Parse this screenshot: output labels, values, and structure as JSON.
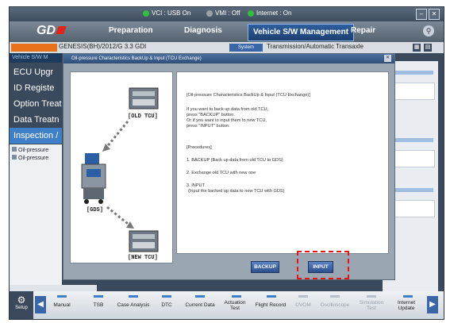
{
  "status": {
    "vci": "VCI : USB On",
    "vmi": "VMI : Off",
    "internet": "Internet : On",
    "vci_color": "#2fbf3a",
    "internet_color": "#2fbf3a"
  },
  "nav": {
    "logo": "GD",
    "tabs": [
      "Preparation",
      "Diagnosis",
      "Vehicle S/W Management",
      "Repair"
    ],
    "active_tab": "Vehicle S/W Management"
  },
  "vehicle": {
    "name": "GENESIS(BH)/2012/G 3.3 GDI",
    "system_button": "System",
    "system_value": "Transmission/Automatic Transaxle"
  },
  "sidebar": {
    "header": "Vehicle S/W M",
    "items": [
      {
        "label": "ECU Upgr"
      },
      {
        "label": "ID Registe"
      },
      {
        "label": "Option Treat"
      },
      {
        "label": "Data Treatn"
      },
      {
        "label": "Inspection /"
      }
    ],
    "sub_items": [
      "Oil-pressure",
      "Oil-pressure"
    ]
  },
  "dialog": {
    "title": "Oil-pressure Characteristics BackUp & Input (TCU Exchange)",
    "labels": {
      "old_tcu": "[OLD TCU]",
      "gds": "[GDS]",
      "new_tcu": "[NEW TCU]"
    },
    "text": {
      "heading": "[Oil-pressure Characteristics BackUp & Input (TCU Exchange)]",
      "line1": "If you want to back up data from old TCU,",
      "line2": "press \"BACKUP\" button.",
      "line3": "Or if you want to input them to new TCU,",
      "line4": "press \"INPUT\" button.",
      "procedures": "[Procedures]",
      "step1": "1. BACKUP (Back up data from old TCU to GDS)",
      "step2": "2. Exchange old TCU with new one",
      "step3": "3. INPUT",
      "step3b": "(Input the backed up data to new TCU with GDS)"
    },
    "buttons": {
      "backup": "BACKUP",
      "input": "INPUT"
    }
  },
  "toolbar": {
    "setup": "Setup",
    "items": [
      {
        "label": "Manual",
        "enabled": true
      },
      {
        "label": "TSB",
        "enabled": true
      },
      {
        "label": "Case Analysis",
        "enabled": true
      },
      {
        "label": "DTC",
        "enabled": true
      },
      {
        "label": "Current Data",
        "enabled": true
      },
      {
        "label": "Actuation Test",
        "enabled": true
      },
      {
        "label": "Flight Record",
        "enabled": true
      },
      {
        "label": "DVOM",
        "enabled": false
      },
      {
        "label": "Oscilloscope",
        "enabled": false
      },
      {
        "label": "Simulation Test",
        "enabled": false
      },
      {
        "label": "Internet Update",
        "enabled": true
      }
    ]
  },
  "colors": {
    "highlight": "#ee1111",
    "active_tab": "#1d3f70",
    "accent_blue": "#3f7fc8"
  }
}
